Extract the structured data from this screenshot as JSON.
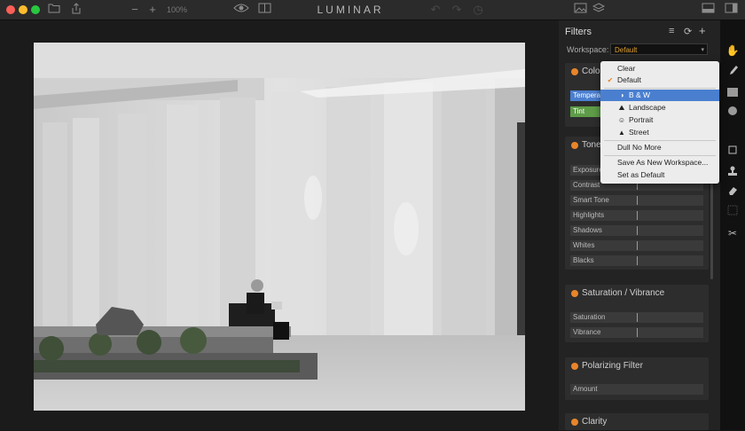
{
  "window": {
    "title": "LUMINAR",
    "zoom": "100%"
  },
  "colors": {
    "accent": "#e8852a",
    "selected": "#4a7fd0",
    "panel_bg": "#232323"
  },
  "toolbar_top": {
    "icons": [
      "folder-icon",
      "share-icon",
      "zoom-out-icon",
      "zoom-in-icon",
      "eye-icon",
      "compare-icon",
      "undo-icon",
      "redo-icon",
      "history-icon",
      "image-icon",
      "layers-icon",
      "panel-icon",
      "sidebar-icon"
    ]
  },
  "filters_panel": {
    "title": "Filters",
    "workspace_label": "Workspace:",
    "workspace_value": "Default",
    "color_section": {
      "title": "Color",
      "sliders": [
        {
          "label": "Temperat",
          "value": 0.5
        },
        {
          "label": "Tint",
          "value": 0.5
        }
      ]
    },
    "tone_section": {
      "title": "Tone",
      "sliders": [
        {
          "label": "Exposure",
          "value": 0.5
        },
        {
          "label": "Contrast",
          "value": 0.5
        },
        {
          "label": "Smart Tone",
          "value": 0.5
        },
        {
          "label": "Highlights",
          "value": 0.5
        },
        {
          "label": "Shadows",
          "value": 0.5
        },
        {
          "label": "Whites",
          "value": 0.5
        },
        {
          "label": "Blacks",
          "value": 0.5
        }
      ]
    },
    "saturation_section": {
      "title": "Saturation / Vibrance",
      "sliders": [
        {
          "label": "Saturation",
          "value": 0.5
        },
        {
          "label": "Vibrance",
          "value": 0.5
        }
      ]
    },
    "polarizing_section": {
      "title": "Polarizing Filter",
      "sliders": [
        {
          "label": "Amount",
          "value": 0.0
        }
      ]
    },
    "clarity_section": {
      "title": "Clarity"
    }
  },
  "workspace_dropdown": {
    "items": [
      {
        "label": "Clear",
        "icon": ""
      },
      {
        "label": "Default",
        "icon": "check-icon",
        "checked": true
      },
      {
        "label": "B & W",
        "icon": "contrast-icon",
        "highlighted": true
      },
      {
        "label": "Landscape",
        "icon": "mountain-icon"
      },
      {
        "label": "Portrait",
        "icon": "face-icon"
      },
      {
        "label": "Street",
        "icon": "street-icon"
      },
      {
        "label": "Dull No More",
        "icon": ""
      },
      {
        "label": "Save As New Workspace...",
        "icon": ""
      },
      {
        "label": "Set as Default",
        "icon": ""
      }
    ]
  },
  "right_tools": [
    "brush-hand-icon",
    "brush-icon",
    "gradient-icon",
    "radial-icon",
    "crop-icon",
    "stamp-icon",
    "eraser-icon",
    "texture-icon",
    "scissors-icon"
  ]
}
